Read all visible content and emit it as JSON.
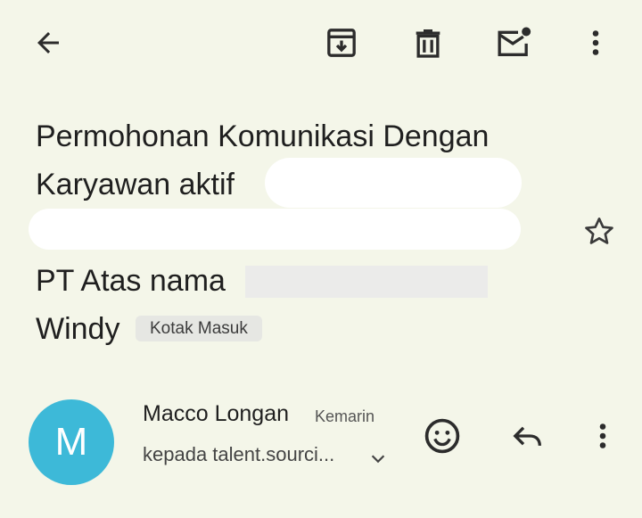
{
  "toolbar": {
    "back_icon": "arrow-left-icon",
    "archive_icon": "archive-icon",
    "delete_icon": "trash-icon",
    "mark_unread_icon": "mail-unread-icon",
    "more_icon": "more-vertical-icon"
  },
  "message": {
    "subject_line_1": "Permohonan Komunikasi Dengan",
    "subject_line_2": "Karyawan aktif",
    "subject_line_4": "PT Atas nama",
    "subject_line_5": "Windy",
    "label": "Kotak Masuk",
    "star_icon": "star-outline-icon"
  },
  "sender": {
    "avatar_letter": "M",
    "avatar_color": "#3db9d8",
    "name": "Macco Longan",
    "time": "Kemarin",
    "recipient": "kepada talent.sourci...",
    "emoji_icon": "emoji-reaction-icon",
    "reply_icon": "reply-icon",
    "more_icon": "more-vertical-icon"
  },
  "colors": {
    "background": "#f4f6e9",
    "text": "#1f1f1f"
  }
}
